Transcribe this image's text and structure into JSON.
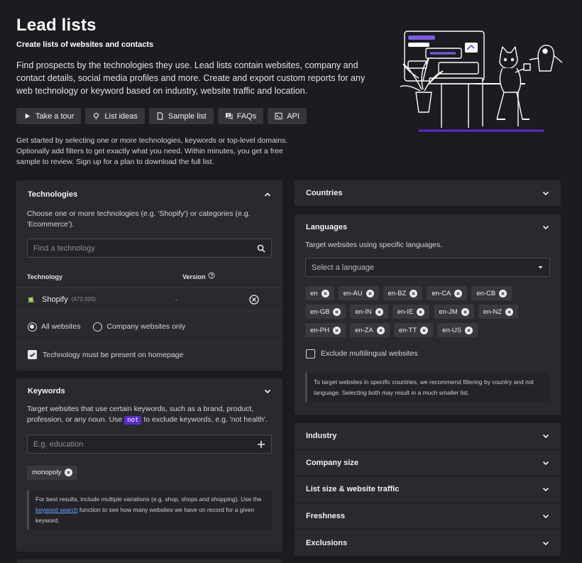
{
  "header": {
    "title": "Lead lists",
    "subtitle": "Create lists of websites and contacts",
    "intro": "Find prospects by the technologies they use. Lead lists contain websites, company and contact details, social media profiles and more. Create and export custom reports for any web technology or keyword based on industry, website traffic and location.",
    "get_started": "Get started by selecting one or more technologies, keywords or top-level domains. Optionally add filters to get exactly what you need. Within minutes, you get a free sample to review. Sign up for a plan to download the full list."
  },
  "buttons": [
    {
      "label": "Take a tour",
      "icon": "play-icon"
    },
    {
      "label": "List ideas",
      "icon": "lightbulb-icon"
    },
    {
      "label": "Sample list",
      "icon": "document-icon"
    },
    {
      "label": "FAQs",
      "icon": "chat-icon"
    },
    {
      "label": "API",
      "icon": "terminal-icon"
    }
  ],
  "technologies": {
    "title": "Technologies",
    "description": "Choose one or more technologies (e.g. 'Shopify') or categories (e.g. 'Ecommerce').",
    "search_placeholder": "Find a technology",
    "col_technology": "Technology",
    "col_version": "Version",
    "rows": [
      {
        "name": "Shopify",
        "count": "(472,000)",
        "version": "-"
      }
    ],
    "radio_all": "All websites",
    "radio_company": "Company websites only",
    "homepage_check": "Technology must be present on homepage"
  },
  "keywords": {
    "title": "Keywords",
    "description_pre": "Target websites that use certain keywords, such as a brand, product, profession, or any noun. Use",
    "code": "not",
    "description_post": "to exclude keywords, e.g. 'not health'.",
    "placeholder": "E.g. education",
    "tags": [
      "monopoly"
    ],
    "note_pre": "For best results, include multiple variations (e.g. shop, shops and shopping). Use the",
    "note_link": "keyword search",
    "note_post": "function to see how many websites we have on record for a given keyword."
  },
  "countries": {
    "title": "Countries"
  },
  "languages": {
    "title": "Languages",
    "description": "Target websites using specific languages.",
    "select_placeholder": "Select a language",
    "tags": [
      "en",
      "en-AU",
      "en-BZ",
      "en-CA",
      "en-CB",
      "en-GB",
      "en-IN",
      "en-IE",
      "en-JM",
      "en-NZ",
      "en-PH",
      "en-ZA",
      "en-TT",
      "en-US"
    ],
    "exclude_label": "Exclude multilingual websites",
    "note": "To target websites in specific countries, we recommend filtering by country and not language. Selecting both may result in a much smaller list."
  },
  "filters": [
    "Industry",
    "Company size",
    "List size & website traffic",
    "Freshness",
    "Exclusions"
  ],
  "colors": {
    "background": "#1c1b1f",
    "panel": "#2a292e",
    "accent": "#5b2bd4",
    "link": "#6aa6ff"
  }
}
